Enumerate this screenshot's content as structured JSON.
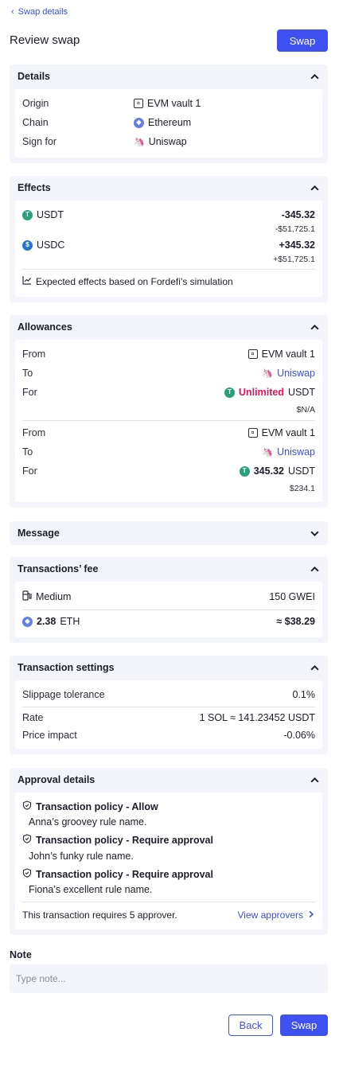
{
  "nav": {
    "back_label": "Swap details"
  },
  "header": {
    "title": "Review swap",
    "swap_label": "Swap"
  },
  "details": {
    "title": "Details",
    "origin_label": "Origin",
    "origin_value": "EVM vault 1",
    "chain_label": "Chain",
    "chain_value": "Ethereum",
    "sign_label": "Sign for",
    "sign_value": "Uniswap"
  },
  "effects": {
    "title": "Effects",
    "items": [
      {
        "token": "USDT",
        "amount": "-345.32",
        "usd": "-$51,725.1"
      },
      {
        "token": "USDC",
        "amount": "+345.32",
        "usd": "+$51,725.1"
      }
    ],
    "note": "Expected effects based on Fordefi’s simulation"
  },
  "allowances": {
    "title": "Allowances",
    "from_label": "From",
    "to_label": "To",
    "for_label": "For",
    "items": [
      {
        "from": "EVM vault 1",
        "to": "Uniswap",
        "amount": "Unlimited",
        "token": "USDT",
        "usd": "$N/A"
      },
      {
        "from": "EVM vault 1",
        "to": "Uniswap",
        "amount": "345.32",
        "token": "USDT",
        "usd": "$234.1"
      }
    ]
  },
  "message": {
    "title": "Message"
  },
  "fee": {
    "title": "Transactions’ fee",
    "speed": "Medium",
    "gwei": "150 GWEI",
    "amount": "2.38",
    "unit": "ETH",
    "usd": "≈ $38.29"
  },
  "settings": {
    "title": "Transaction settings",
    "slippage_label": "Slippage tolerance",
    "slippage_value": "0.1%",
    "rate_label": "Rate",
    "rate_value": "1 SOL ≈ 141.23452 USDT",
    "impact_label": "Price impact",
    "impact_value": "-0.06%"
  },
  "approval": {
    "title": "Approval details",
    "policies": [
      {
        "name": "Transaction policy - Allow",
        "rule": "Anna’s groovey rule name."
      },
      {
        "name": "Transaction policy - Require approval",
        "rule": "John’s funky rule name."
      },
      {
        "name": "Transaction policy - Require approval",
        "rule": "Fiona’s excellent rule name."
      }
    ],
    "requirement": "This transaction requires 5 approver.",
    "view_label": "View approvers"
  },
  "note": {
    "label": "Note",
    "placeholder": "Type note..."
  },
  "footer": {
    "back_label": "Back",
    "swap_label": "Swap"
  },
  "colors": {
    "accent": "#3f51f0",
    "link": "#3a50e0",
    "panel_bg": "#f4f5fa",
    "unlimited": "#e0145a",
    "usdt": "#26a17b",
    "usdc": "#2775ca",
    "eth": "#627eea",
    "uniswap": "#ff007a"
  }
}
